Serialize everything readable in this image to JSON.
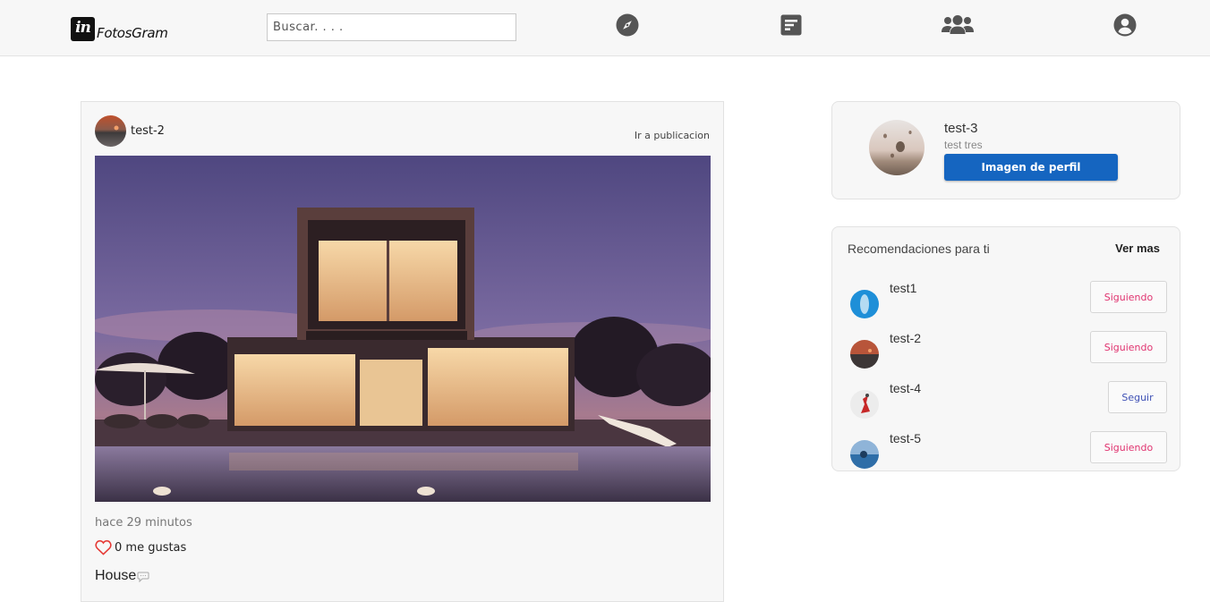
{
  "navbar": {
    "logo_text": "in",
    "brand": "FotosGram",
    "search_placeholder": "Buscar. . . .",
    "icons": [
      "compass-icon",
      "feed-icon",
      "users-icon",
      "account-icon"
    ]
  },
  "post": {
    "username": "test-2",
    "link": "Ir a publicacion",
    "image_desc": "house-photo",
    "time": "hace 29 minutos",
    "likes": "0 me gustas",
    "caption": "House",
    "colors": {
      "heart": "#e53935"
    }
  },
  "profile": {
    "username": "test-3",
    "name": "test tres",
    "button": "Imagen de perfil",
    "colors": {
      "button": "#1565c0"
    }
  },
  "recommendations": {
    "title": "Recomendaciones para ti",
    "more": "Ver mas",
    "items": [
      {
        "username": "test1",
        "button": "Siguiendo",
        "state": "following"
      },
      {
        "username": "test-2",
        "button": "Siguiendo",
        "state": "following"
      },
      {
        "username": "test-4",
        "button": "Seguir",
        "state": "follow"
      },
      {
        "username": "test-5",
        "button": "Siguiendo",
        "state": "following"
      }
    ],
    "colors": {
      "following": "#e0336f",
      "follow": "#3f51b5"
    }
  }
}
